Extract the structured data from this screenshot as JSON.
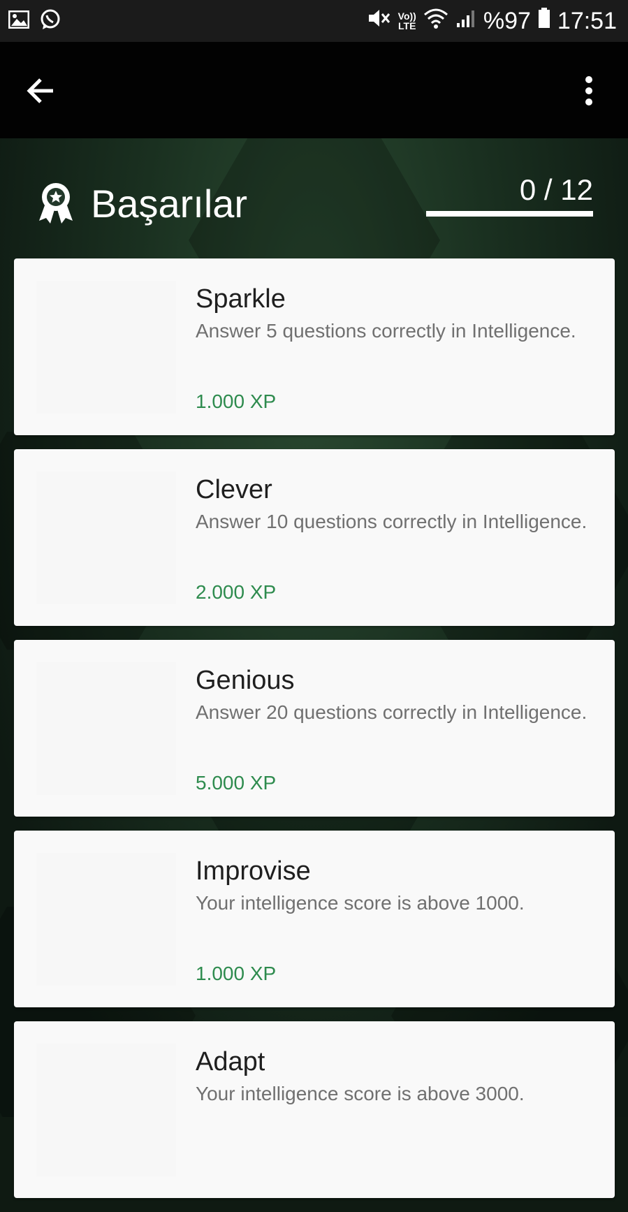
{
  "status_bar": {
    "left_icons": [
      "gallery-icon",
      "whatsapp-icon"
    ],
    "right_icons": [
      "mute-icon",
      "wifi-icon",
      "signal-icon",
      "battery-icon"
    ],
    "volte_label_top": "Vo))",
    "volte_label_bottom": "LTE",
    "battery": "%97",
    "time": "17:51"
  },
  "app_bar": {
    "back_icon": "arrow-left-icon",
    "menu_icon": "more-vert-icon"
  },
  "header": {
    "icon": "award-ribbon-icon",
    "title": "Başarılar",
    "progress_text": "0 / 12",
    "progress_value": 0,
    "progress_total": 12
  },
  "colors": {
    "app_bar": "#020202",
    "status_bar": "#1b1b1b",
    "background": "#1a3020",
    "card": "#f9f9f9",
    "xp": "#2e8b4e",
    "title": "#1f1f1f",
    "description": "#707070"
  },
  "achievements": [
    {
      "title": "Sparkle",
      "description": "Answer 5 questions correctly in Intelligence.",
      "xp": "1.000 XP"
    },
    {
      "title": "Clever",
      "description": "Answer 10 questions correctly in Intelligence.",
      "xp": "2.000 XP"
    },
    {
      "title": "Genious",
      "description": "Answer 20 questions correctly in Intelligence.",
      "xp": "5.000 XP"
    },
    {
      "title": "Improvise",
      "description": "Your intelligence score is above 1000.",
      "xp": "1.000 XP"
    },
    {
      "title": "Adapt",
      "description": "Your intelligence score is above 3000.",
      "xp": ""
    }
  ]
}
